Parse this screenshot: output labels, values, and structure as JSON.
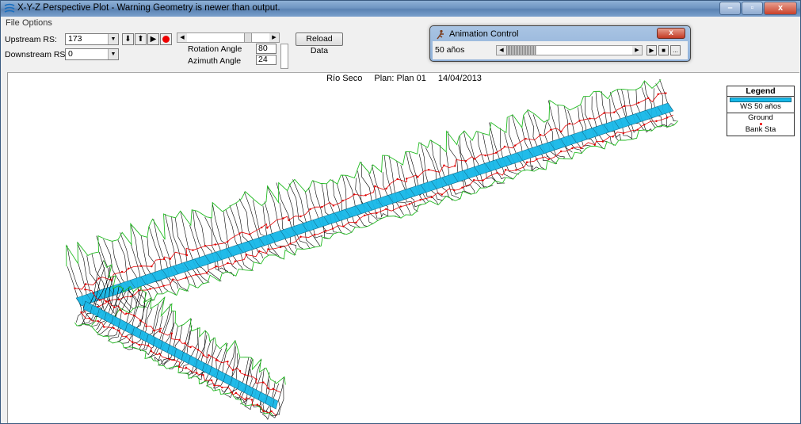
{
  "window": {
    "title": "X-Y-Z Perspective Plot - Warning Geometry is newer than output.",
    "controls": {
      "minimize": "–",
      "maximize": "▫",
      "close": "x"
    }
  },
  "menu": {
    "file": "File",
    "options": "Options"
  },
  "toolbar": {
    "upstream_label": "Upstream RS:",
    "upstream_value": "173",
    "downstream_label": "Downstream RS:",
    "downstream_value": "0",
    "rotation_label": "Rotation Angle",
    "rotation_value": "80",
    "azimuth_label": "Azimuth Angle",
    "azimuth_value": "24",
    "reload_label": "Reload Data"
  },
  "animation": {
    "title": "Animation Control",
    "profile": "50 años",
    "close": "x",
    "more": "..."
  },
  "plot": {
    "river": "Río Seco",
    "plan": "Plan: Plan 01",
    "date": "14/04/2013"
  },
  "legend": {
    "title": "Legend",
    "ws": "WS 50 años",
    "ground": "Ground",
    "bank": "Bank Sta"
  },
  "colors": {
    "water": "#16b8e8",
    "ground": "#000000",
    "bank": "#e00000",
    "envelope": "#22bb22"
  }
}
